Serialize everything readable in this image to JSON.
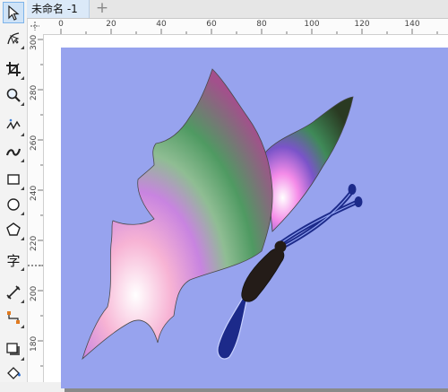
{
  "document": {
    "tab_title": "未命名 -1",
    "add_tab_label": "+"
  },
  "rulers": {
    "horizontal_ticks": [
      "0",
      "20",
      "40",
      "60",
      "80",
      "100",
      "120",
      "140"
    ],
    "vertical_ticks": [
      "300",
      "280",
      "260",
      "240",
      "220",
      "200",
      "180"
    ]
  },
  "toolbox": {
    "items": [
      {
        "icon": "pick-tool-icon",
        "active": true
      },
      {
        "icon": "shape-tool-icon"
      },
      {
        "icon": "crop-tool-icon"
      },
      {
        "icon": "zoom-tool-icon"
      },
      {
        "icon": "freehand-tool-icon"
      },
      {
        "icon": "artistic-media-icon"
      },
      {
        "icon": "rectangle-tool-icon"
      },
      {
        "icon": "ellipse-tool-icon"
      },
      {
        "icon": "polygon-tool-icon"
      },
      {
        "icon": "text-tool-icon",
        "label": "字"
      },
      {
        "icon": "dimension-tool-icon"
      },
      {
        "icon": "connector-tool-icon"
      },
      {
        "icon": "drop-shadow-icon"
      },
      {
        "icon": "fill-tool-icon"
      }
    ]
  },
  "colors": {
    "page_background": "#97a3ee",
    "body_dark": "#241c18",
    "tail_blue": "#1c2a8a"
  }
}
